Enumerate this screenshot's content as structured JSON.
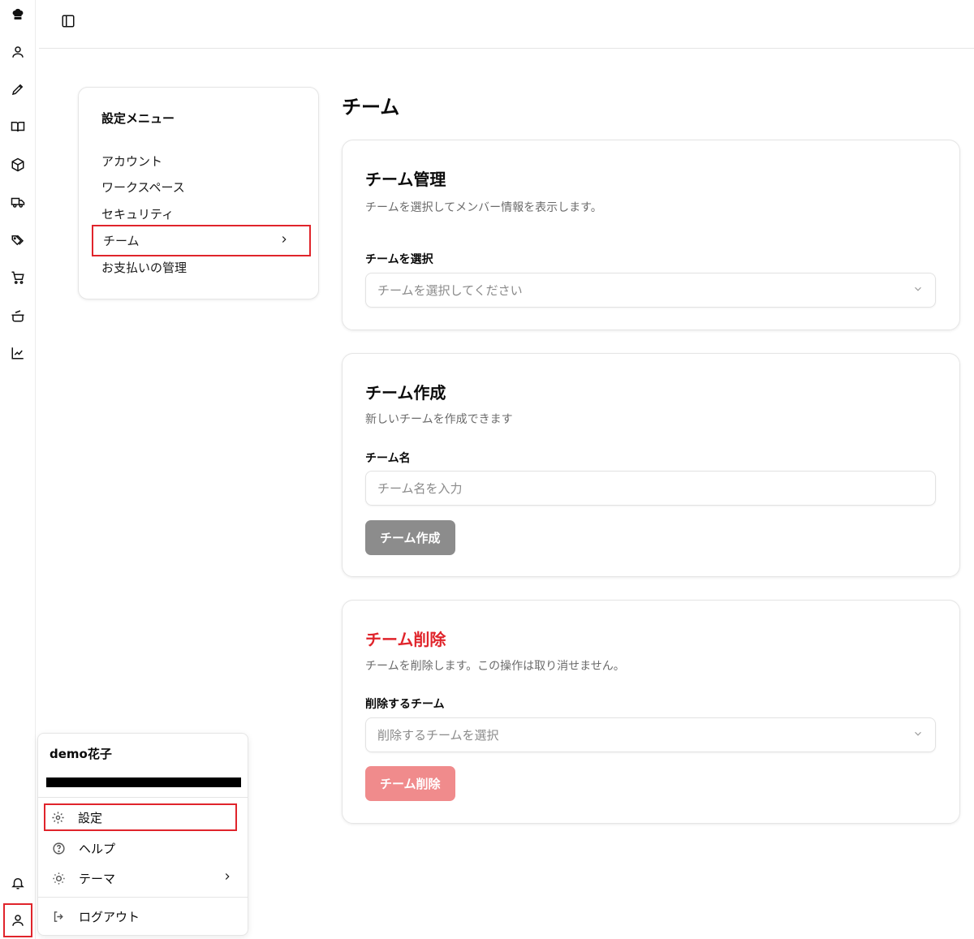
{
  "rail": {
    "icons": [
      "chef-hat-icon",
      "user-icon",
      "pen-icon",
      "book-icon",
      "box-icon",
      "truck-icon",
      "tags-icon",
      "cart-icon",
      "cooking-pot-icon",
      "chart-icon"
    ],
    "bottom_icons": [
      "bell-icon",
      "user-icon"
    ]
  },
  "topbar": {
    "toggle_icon": "sidebar-toggle-icon"
  },
  "settings_menu": {
    "title": "設定メニュー",
    "items": [
      {
        "label": "アカウント"
      },
      {
        "label": "ワークスペース"
      },
      {
        "label": "セキュリティ"
      },
      {
        "label": "チーム",
        "active": true
      },
      {
        "label": "お支払いの管理"
      }
    ]
  },
  "page": {
    "title": "チーム"
  },
  "team_manage": {
    "title": "チーム管理",
    "description": "チームを選択してメンバー情報を表示します。",
    "select_label": "チームを選択",
    "select_placeholder": "チームを選択してください"
  },
  "team_create": {
    "title": "チーム作成",
    "description": "新しいチームを作成できます",
    "name_label": "チーム名",
    "name_placeholder": "チーム名を入力",
    "button": "チーム作成"
  },
  "team_delete": {
    "title": "チーム削除",
    "description": "チームを削除します。この操作は取り消せません。",
    "select_label": "削除するチーム",
    "select_placeholder": "削除するチームを選択",
    "button": "チーム削除"
  },
  "user_popup": {
    "name": "demo花子",
    "items": [
      {
        "label": "設定",
        "icon": "gear-icon"
      },
      {
        "label": "ヘルプ",
        "icon": "help-circle-icon"
      },
      {
        "label": "テーマ",
        "icon": "sun-icon"
      },
      {
        "label": "ログアウト",
        "icon": "logout-icon"
      }
    ]
  },
  "colors": {
    "accent_red": "#e0242b",
    "button_gray": "#8c8c8c",
    "button_red_disabled": "#f08b8c"
  }
}
